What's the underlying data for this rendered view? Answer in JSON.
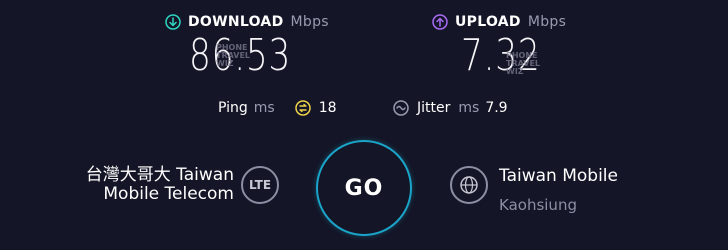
{
  "download": {
    "label": "DOWNLOAD",
    "unit": "Mbps",
    "value": "86.53",
    "accent": "#2fd6c2"
  },
  "upload": {
    "label": "UPLOAD",
    "unit": "Mbps",
    "value": "7.32",
    "accent": "#a86cf5"
  },
  "watermark": {
    "line1": "PHONE",
    "line2": "TRAVEL",
    "line3": "WIZ"
  },
  "ping": {
    "label": "Ping",
    "unit": "ms",
    "value": "18",
    "icon_color": "#f0d34a"
  },
  "jitter": {
    "label": "Jitter",
    "unit": "ms",
    "value": "7.9"
  },
  "go": {
    "label": "GO",
    "ring_color": "#1aa4c8"
  },
  "provider": {
    "name_line1": "台灣大哥大 Taiwan",
    "name_line2": "Mobile Telecom",
    "connection": "LTE"
  },
  "server": {
    "name": "Taiwan Mobile",
    "location": "Kaohsiung"
  },
  "icons": [
    "download-arrow-icon",
    "upload-arrow-icon",
    "ping-icon",
    "jitter-icon",
    "globe-icon"
  ]
}
